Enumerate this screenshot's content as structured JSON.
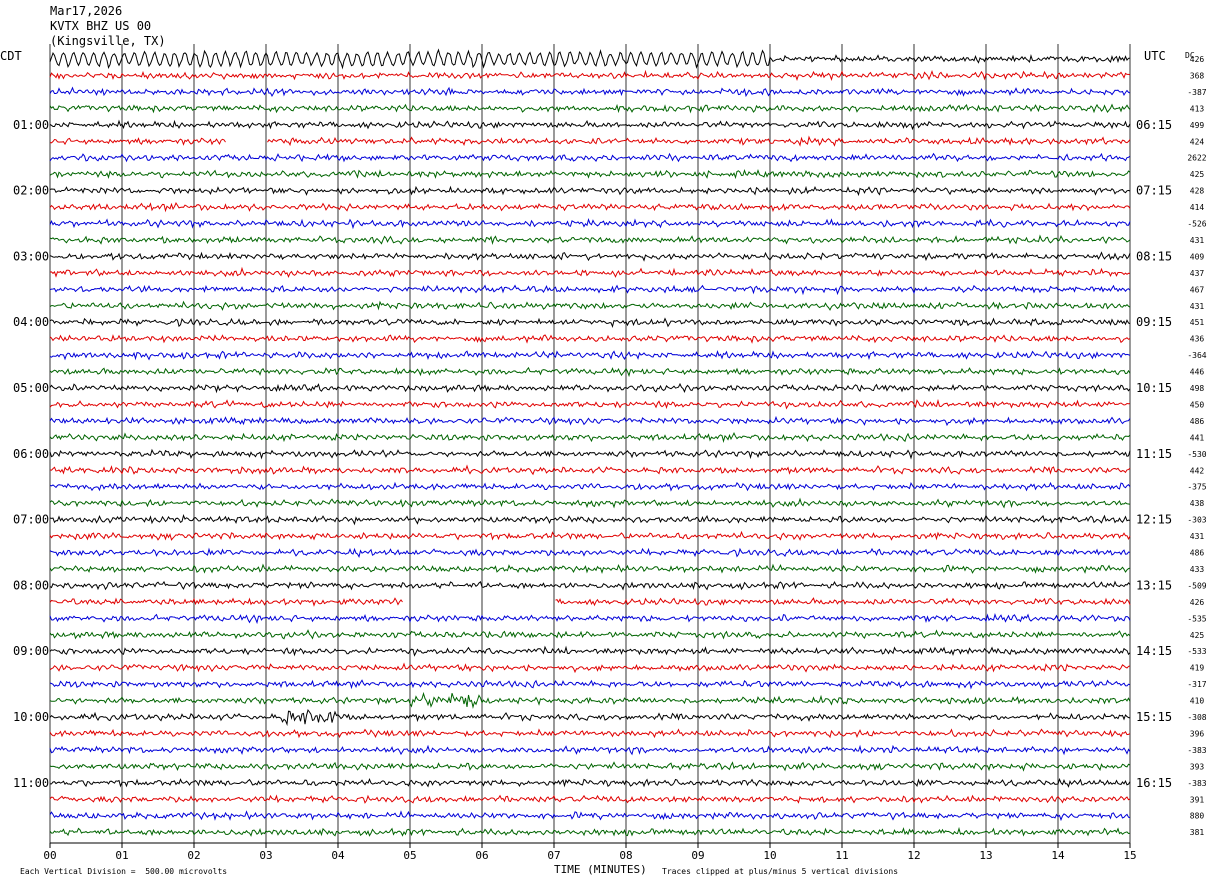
{
  "header": {
    "date": "Mar17,2026",
    "station": "KVTX BHZ US 00",
    "location": "(Kingsville, TX)",
    "left_tz": "CDT",
    "right_tz": "UTC",
    "dc_label": "DC"
  },
  "footer": {
    "scale_note": "Each Vertical Division =  500.00 microvolts",
    "xlabel": "TIME (MINUTES)",
    "clip_note": "Traces clipped at plus/minus 5 vertical divisions"
  },
  "colors": {
    "cycle": [
      "#000000",
      "#e00000",
      "#0000d8",
      "#006400"
    ],
    "grid": "#000000"
  },
  "chart_data": {
    "type": "line",
    "title": "KVTX BHZ US 00 (Kingsville, TX) Mar17,2026",
    "xlabel": "TIME (MINUTES)",
    "xlim": [
      0,
      15
    ],
    "x_ticks": [
      "00",
      "01",
      "02",
      "03",
      "04",
      "05",
      "06",
      "07",
      "08",
      "09",
      "10",
      "11",
      "12",
      "13",
      "14",
      "15"
    ],
    "rows_per_hour": 4,
    "row_minutes": 15,
    "left_hour_labels": [
      "01:00",
      "02:00",
      "03:00",
      "04:00",
      "05:00",
      "06:00",
      "07:00",
      "08:00",
      "09:00",
      "10:00",
      "11:00"
    ],
    "right_hour_labels": [
      "06:15",
      "07:15",
      "08:15",
      "09:15",
      "10:15",
      "11:15",
      "12:15",
      "13:15",
      "14:15",
      "15:15",
      "16:15"
    ],
    "dc_offsets": [
      "426",
      "368",
      "-387",
      "413",
      "499",
      "424",
      "2622",
      "425",
      "428",
      "414",
      "-526",
      "431",
      "409",
      "437",
      "467",
      "431",
      "451",
      "436",
      "-364",
      "446",
      "498",
      "450",
      "486",
      "441",
      "-530",
      "442",
      "-375",
      "438",
      "-303",
      "431",
      "486",
      "433",
      "-509",
      "426",
      "-535",
      "425",
      "-533",
      "419",
      "-317",
      "410",
      "-308",
      "396",
      "-383",
      "393",
      "-383",
      "391",
      "880",
      "381"
    ],
    "gaps": [
      {
        "row": 5,
        "start_min": 2.45,
        "end_min": 3.0
      },
      {
        "row": 33,
        "start_min": 4.9,
        "end_min": 7.0
      }
    ],
    "events": [
      {
        "row": 0,
        "start_min": 0.0,
        "end_min": 10.0,
        "note": "large amplitude oscillation"
      },
      {
        "row": 39,
        "start_min": 5.0,
        "end_min": 6.0,
        "note": "burst"
      },
      {
        "row": 40,
        "start_min": 3.2,
        "end_min": 4.0,
        "note": "burst"
      }
    ],
    "clip_divisions": 5,
    "grid": true
  }
}
